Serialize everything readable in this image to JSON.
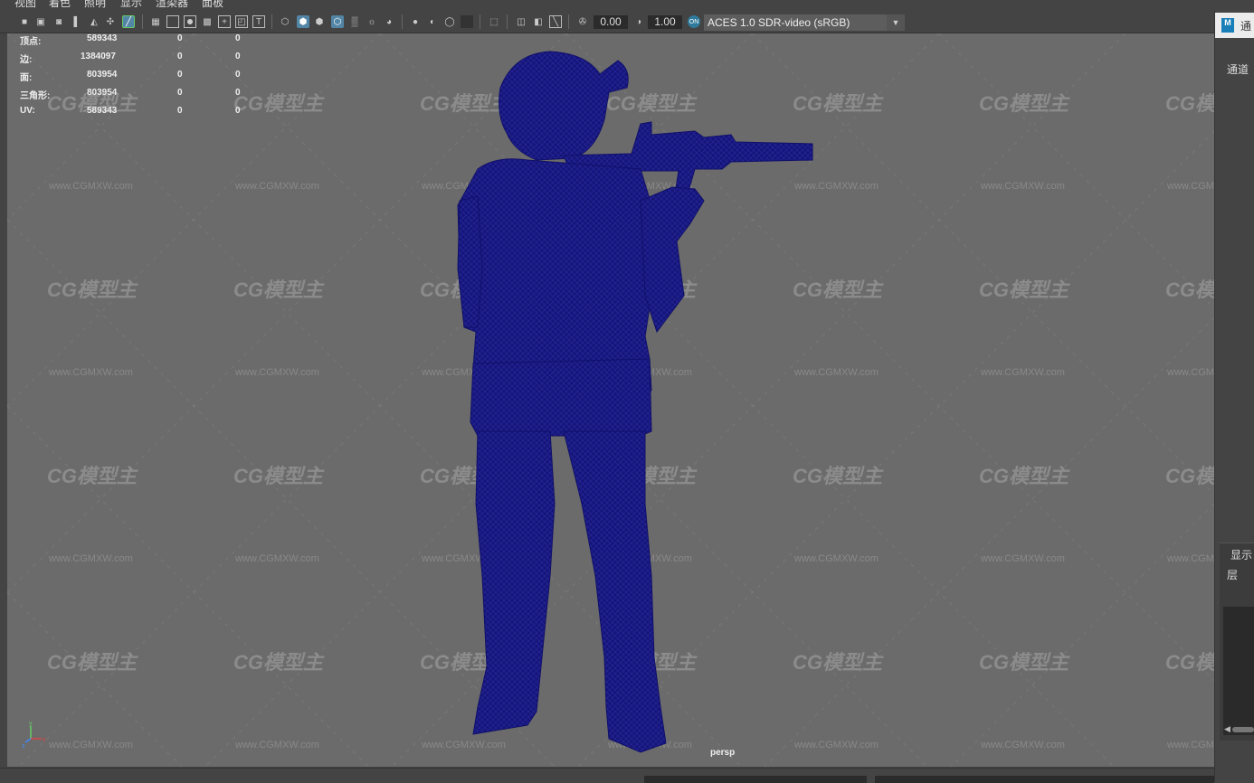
{
  "menu": {
    "items": [
      "视图",
      "着色",
      "照明",
      "显示",
      "渲染器",
      "面板"
    ]
  },
  "toolbar": {
    "exposure_value": "0.00",
    "gamma_value": "1.00",
    "color_space": "ACES 1.0 SDR-video (sRGB)",
    "icons": [
      "camera-icon",
      "camera-attr-icon",
      "bookmark-icon",
      "image-plane-icon",
      "grid-icon",
      "film-gate-icon",
      "resolution-gate-icon",
      "gate-mask-icon",
      "field-chart-icon",
      "safe-action-icon",
      "safe-title-icon",
      "wireframe-icon",
      "smooth-shade-icon",
      "wireframe-on-shaded-icon",
      "textured-icon",
      "lights-icon",
      "shadows-icon",
      "screen-space-ao-icon",
      "motion-blur-icon",
      "multisample-aa-icon",
      "depth-of-field-icon",
      "isolate-select-icon",
      "xray-icon",
      "xray-joints-icon",
      "backface-cull-icon",
      "exposure-icon",
      "gamma-icon",
      "color-management-icon"
    ]
  },
  "hud": {
    "rows": [
      {
        "label": "顶点:",
        "v1": "589343",
        "v2": "0",
        "v3": "0"
      },
      {
        "label": "边:",
        "v1": "1384097",
        "v2": "0",
        "v3": "0"
      },
      {
        "label": "面:",
        "v1": "803954",
        "v2": "0",
        "v3": "0"
      },
      {
        "label": "三角形:",
        "v1": "803954",
        "v2": "0",
        "v3": "0"
      },
      {
        "label": "UV:",
        "v1": "589343",
        "v2": "0",
        "v3": "0"
      }
    ]
  },
  "viewport": {
    "camera": "persp",
    "model_color": "#15157a",
    "background": "#6b6b6b",
    "watermark_logo": "CG模型主",
    "watermark_url": "www.CGMXW.com"
  },
  "axis": {
    "x": "x",
    "y": "y",
    "z": "z"
  },
  "right_panel": {
    "tab_logo": "M",
    "tab_label": "通",
    "channels_label": "通道",
    "display_title": "显示",
    "layer_label": "层"
  }
}
